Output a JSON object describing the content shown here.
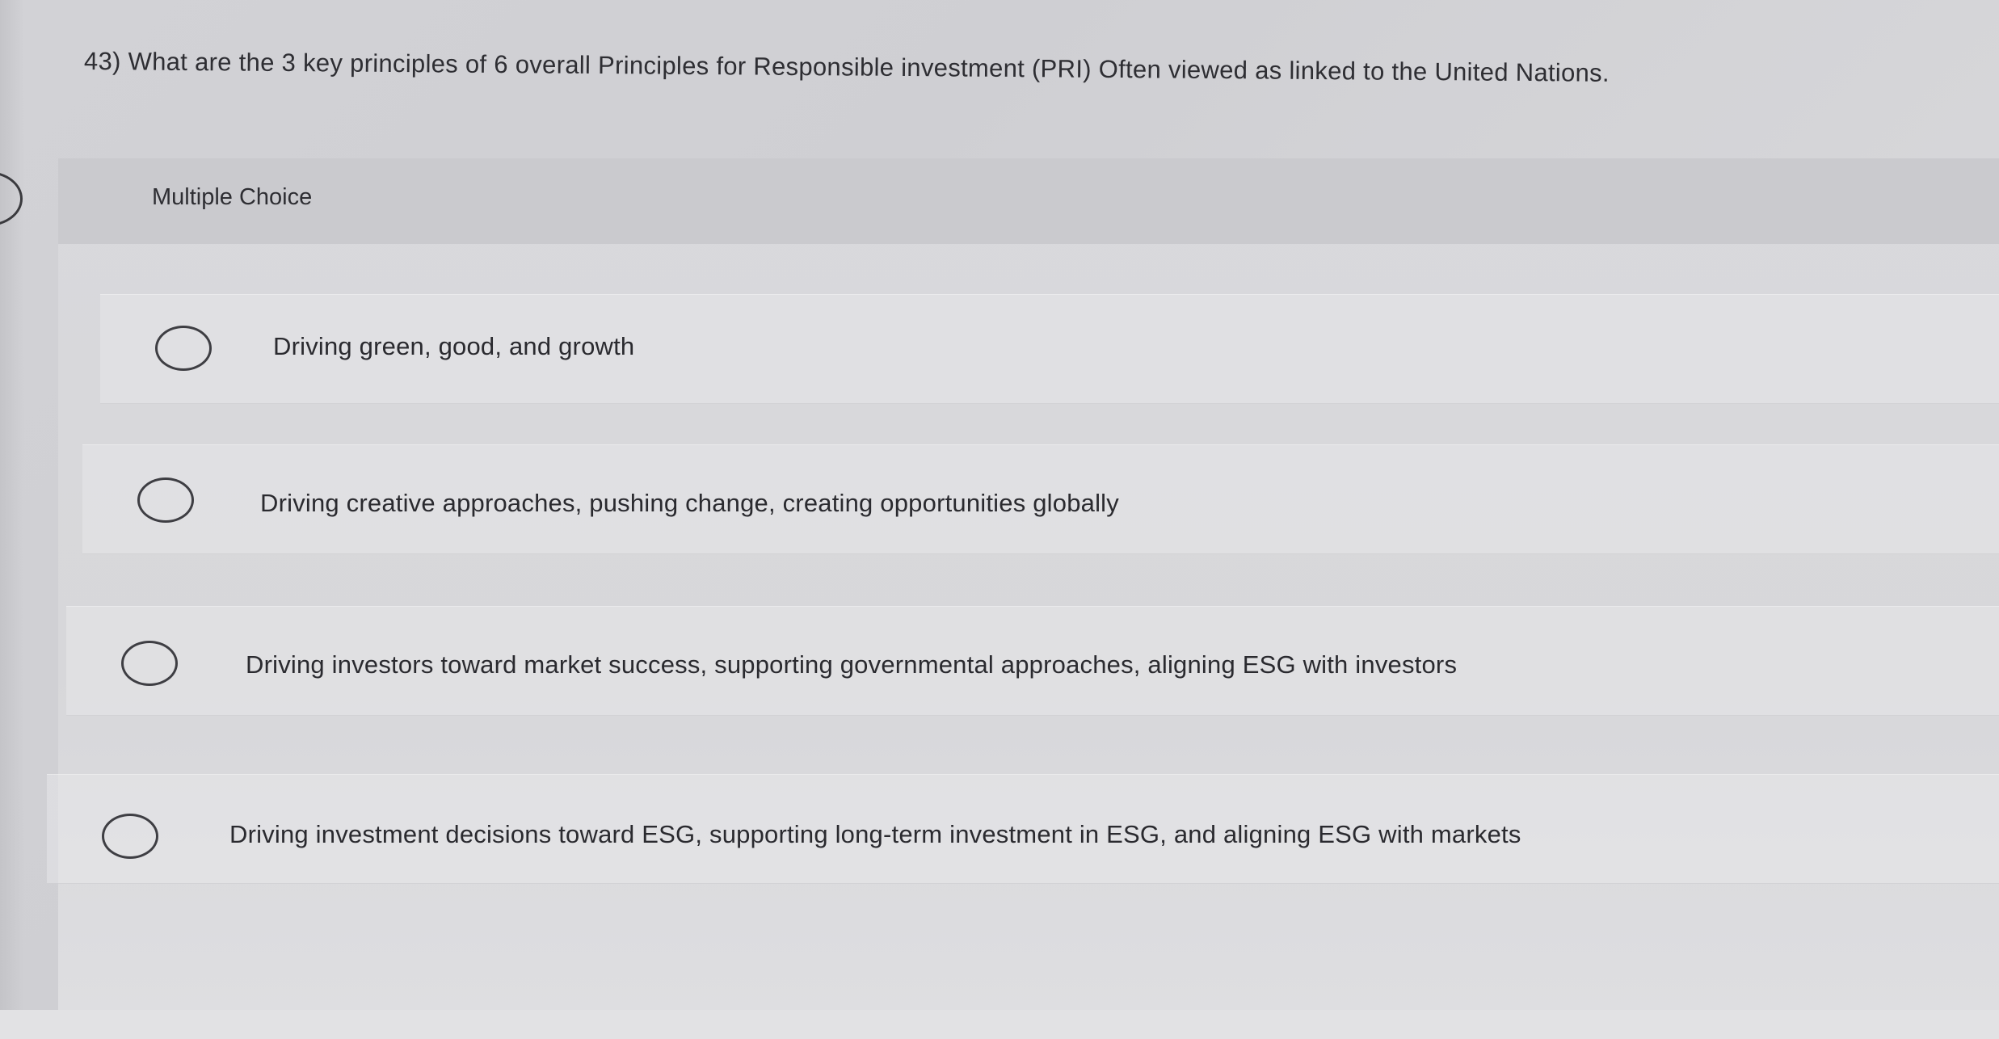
{
  "question": {
    "text": "43) What are the 3 key principles of 6 overall Principles for Responsible investment (PRI) Often viewed as linked to the United Nations."
  },
  "multiple_choice": {
    "label": "Multiple Choice",
    "options": [
      {
        "label": "Driving green, good, and growth",
        "selected": false
      },
      {
        "label": "Driving creative approaches, pushing change, creating opportunities globally",
        "selected": false
      },
      {
        "label": "Driving investors toward market success, supporting governmental approaches, aligning ESG with investors",
        "selected": false
      },
      {
        "label": "Driving investment decisions toward ESG, supporting long-term investment in ESG, and aligning ESG with markets",
        "selected": false
      }
    ]
  },
  "colors": {
    "text": "#2b2b2e",
    "header_band": "#cacace",
    "radio_border": "#3e3e43"
  }
}
